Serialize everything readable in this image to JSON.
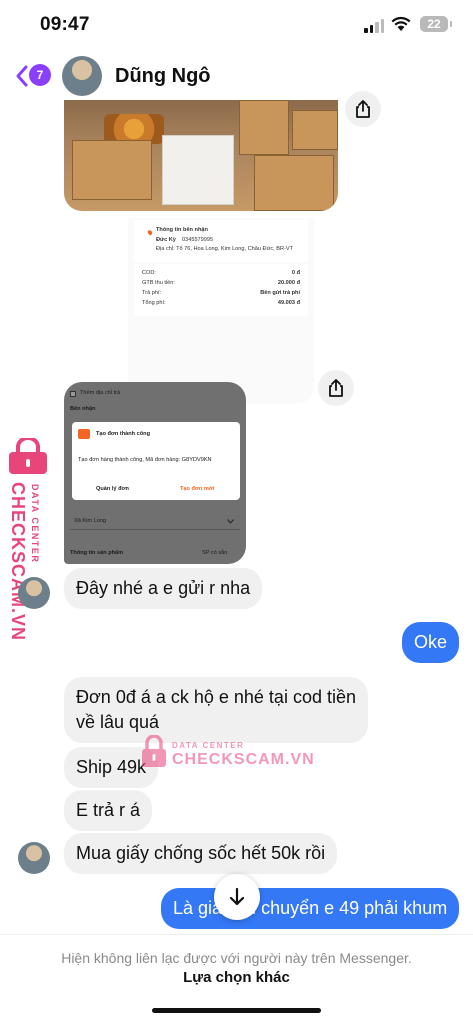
{
  "status_bar": {
    "time": "09:47",
    "battery": "22"
  },
  "header": {
    "back_badge_count": "7",
    "contact_name": "Dũng Ngô",
    "icons": [
      "chevron-left-icon",
      "avatar"
    ]
  },
  "receipt": {
    "section_title": "Thông tin bên nhận",
    "recipient_name": "Đức Kỳ",
    "recipient_phone": "0345579995",
    "address": "Địa chỉ: Tổ 76, Hoa Long, Kim Long, Châu Đức, BR-VT",
    "rows": [
      {
        "label": "COD:",
        "value": "0 đ"
      },
      {
        "label": "GTB thu tiền:",
        "value": "20.000 đ"
      },
      {
        "label": "Trả phí:",
        "value": "Bên gửi trả phí"
      },
      {
        "label": "Tổng phí:",
        "value": "49.003 đ"
      }
    ]
  },
  "app_screenshot": {
    "checkbox_label": "Thêm địa chỉ trả",
    "section_receiver": "Bên nhận",
    "dialog_title": "Tạo đơn thành công",
    "dialog_message": "Tạo đơn hàng thành công, Mã đơn hàng: G8YDV9KN",
    "dialog_left_button": "Quản lý đơn",
    "dialog_right_button": "Tạo đơn mới",
    "dropdown_value": "Xã Kim Long",
    "products_label": "Thông tin sản phẩm",
    "products_action": "SP có sẵn"
  },
  "messages": [
    {
      "direction": "in",
      "text": "Đây nhé a e gửi r nha"
    },
    {
      "direction": "out",
      "text": "Oke"
    },
    {
      "direction": "in",
      "text_line1": "Đơn 0đ á a ck hộ e nhé tại cod tiền",
      "text_line2": "về lâu quá"
    },
    {
      "direction": "in",
      "text": "Ship 49k"
    },
    {
      "direction": "in",
      "text": "E trả r á"
    },
    {
      "direction": "in",
      "text": "Mua giấy chống sốc hết 50k rồi"
    },
    {
      "direction": "out",
      "text": "Là giá vận chuyển e 49 phải khum"
    }
  ],
  "footer": {
    "notice": "Hiện không liên lạc được với người này trên Messenger.",
    "action": "Lựa chọn khác"
  },
  "watermark": {
    "brand": "CHECKSCAM.VN",
    "tagline": "DATA CENTER",
    "color": "#e8457a"
  },
  "colors": {
    "outgoing_bubble": "#3478f6",
    "incoming_bubble": "#f0f0f0",
    "badge": "#8a3ffc"
  }
}
